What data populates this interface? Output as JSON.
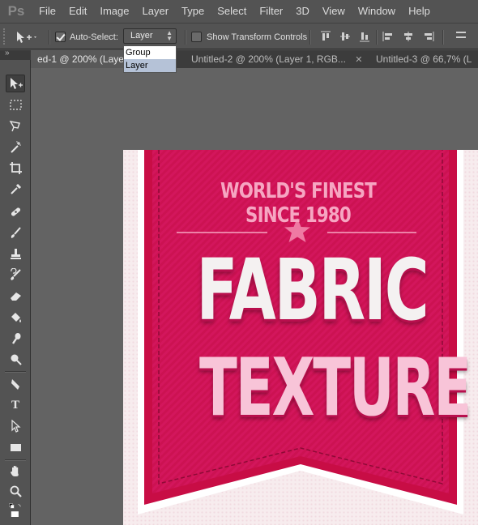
{
  "app": {
    "logo": "Ps"
  },
  "menu": [
    "File",
    "Edit",
    "Image",
    "Layer",
    "Type",
    "Select",
    "Filter",
    "3D",
    "View",
    "Window",
    "Help"
  ],
  "options": {
    "auto_select_label": "Auto-Select:",
    "auto_select_checked": true,
    "auto_select_value": "Layer",
    "auto_select_options": [
      "Group",
      "Layer"
    ],
    "show_transform_label": "Show Transform Controls",
    "show_transform_checked": false
  },
  "tabs": [
    {
      "label": "ed-1 @ 200% (Layer",
      "active": true
    },
    {
      "label": "Untitled-2 @ 200% (Layer 1, RGB...",
      "active": false
    },
    {
      "label": "Untitled-3 @ 66,7% (L",
      "active": false
    }
  ],
  "tools": [
    "move-tool",
    "marquee-tool",
    "lasso-tool",
    "magic-wand-tool",
    "crop-tool",
    "eyedropper-tool",
    "healing-brush-tool",
    "brush-tool",
    "clone-stamp-tool",
    "history-brush-tool",
    "eraser-tool",
    "paint-bucket-tool",
    "smudge-tool",
    "dodge-tool",
    "pen-tool",
    "type-tool",
    "path-selection-tool",
    "rectangle-tool",
    "hand-tool",
    "zoom-tool"
  ],
  "document": {
    "tagline": "WORLD'S FINEST SINCE 1980",
    "title_line1": "FABRIC",
    "title_line2": "TEXTURE"
  },
  "colors": {
    "ribbon": "#d81b60",
    "ribbon_dark": "#b5134b",
    "canvas_bg": "#f7ecee",
    "workspace": "#636363",
    "ui_panel": "#535353"
  }
}
